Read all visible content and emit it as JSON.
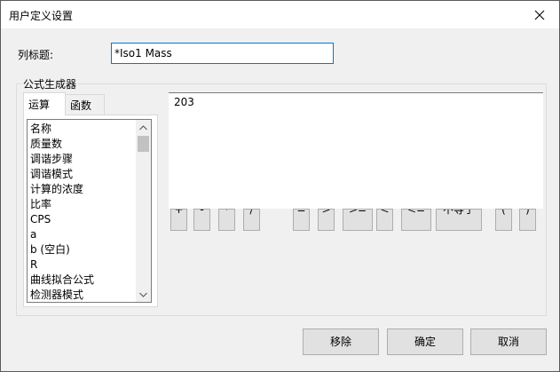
{
  "window": {
    "title": "用户定义设置"
  },
  "column_title": {
    "label": "列标题:",
    "value": "*Iso1 Mass"
  },
  "formula_group": {
    "legend": "公式生成器",
    "tabs": [
      "运算",
      "函数"
    ],
    "items": [
      "名称",
      "质量数",
      "调谐步骤",
      "调谐模式",
      "计算的浓度",
      "比率",
      "CPS",
      "a",
      "b (空白)",
      "R",
      "曲线拟合公式",
      "检测器模式"
    ],
    "expression": "203",
    "operators": [
      "+",
      "-",
      "*",
      "/",
      "=",
      ">",
      ">=",
      "<",
      "<=",
      "不等于",
      "(",
      ")"
    ]
  },
  "buttons": {
    "remove": "移除",
    "ok": "确定",
    "cancel": "取消"
  },
  "colors": {
    "focus_border": "#0078d7",
    "button_face": "#e1e1e1",
    "dialog_bg": "#f0f0f0"
  }
}
